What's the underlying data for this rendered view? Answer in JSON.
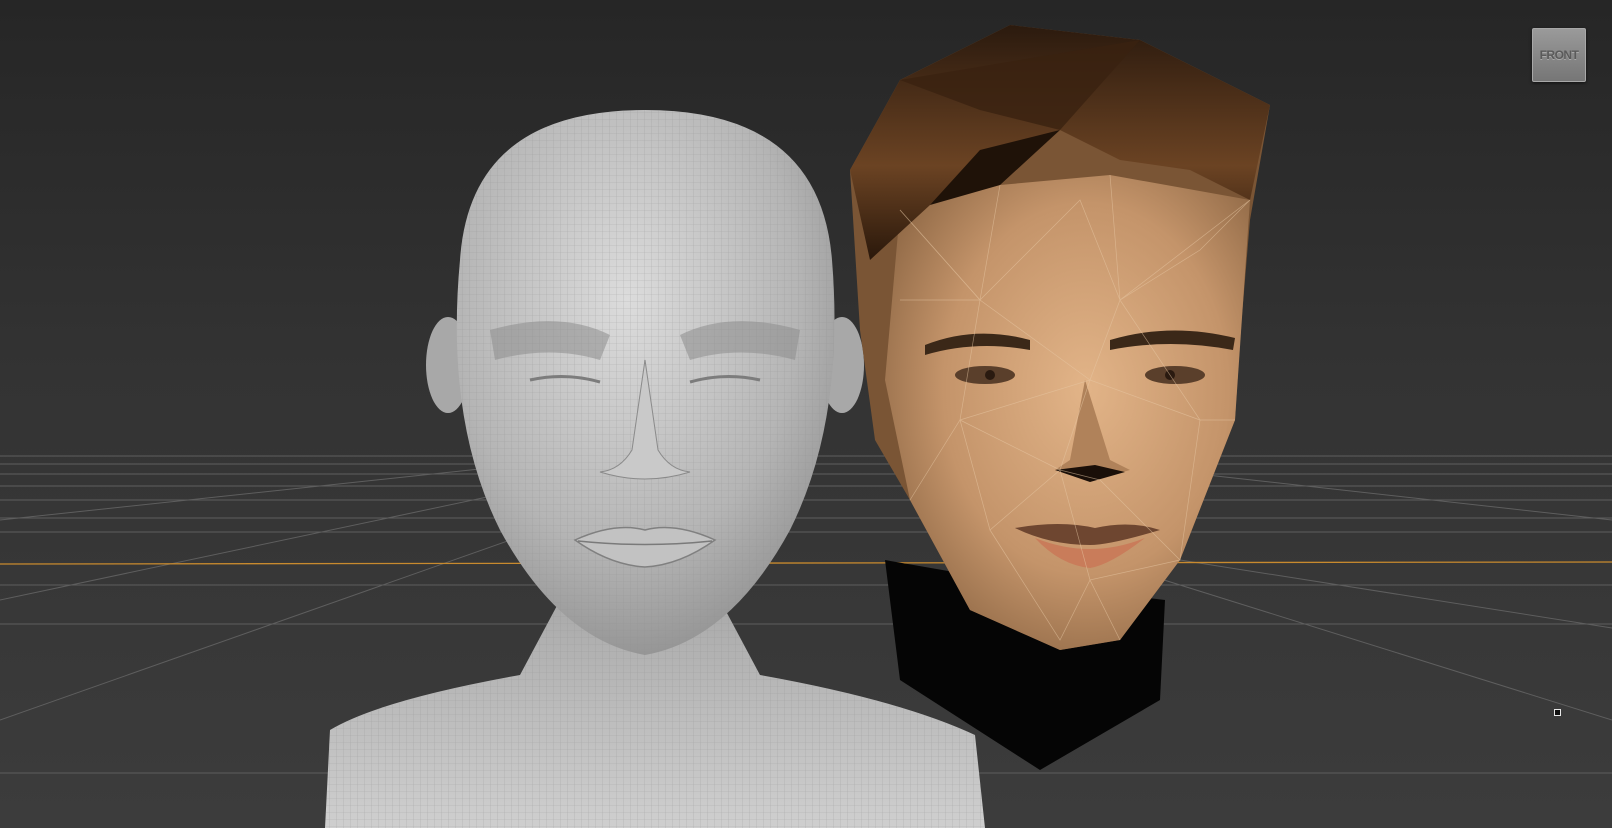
{
  "viewport": {
    "view_label": "FRONT",
    "background_top": "#262626",
    "background_bottom": "#3c3c3c",
    "grid_color": "#5a5a5a",
    "axis_x_color": "#c88a2e",
    "axis_y_color": "#b89530"
  },
  "objects": [
    {
      "name": "wireframe-head-model",
      "shading": "clay-with-wireframe",
      "color": "#bdbdbd"
    },
    {
      "name": "textured-lowpoly-head",
      "shading": "textured",
      "skin_color": "#c99a6e",
      "hair_color": "#4a2c17"
    }
  ]
}
